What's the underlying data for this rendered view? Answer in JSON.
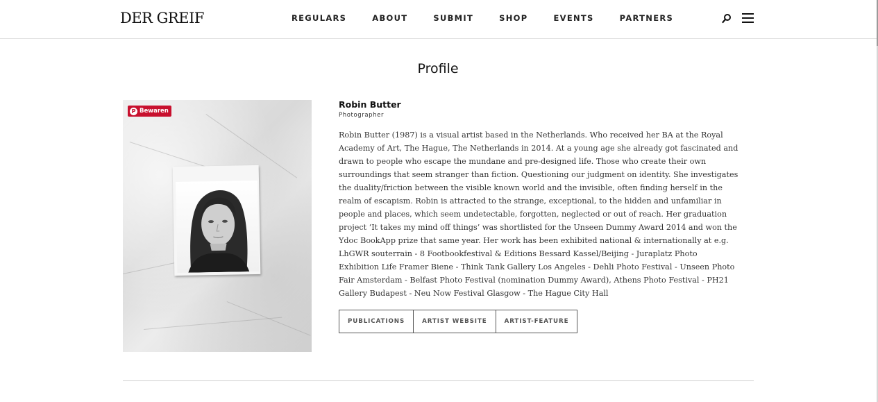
{
  "header": {
    "logo": "DER GREIF",
    "nav": [
      "REGULARS",
      "ABOUT",
      "SUBMIT",
      "SHOP",
      "EVENTS",
      "PARTNERS"
    ],
    "icons": [
      "search-icon",
      "hamburger-menu-icon"
    ]
  },
  "page": {
    "title": "Profile"
  },
  "profile": {
    "pin_button_label": "Bewaren",
    "name": "Robin Butter",
    "role": "Photographer",
    "bio_lines": [
      "Robin Butter (1987) is a visual artist based in the Netherlands. Who received her BA at the Royal",
      "Academy of Art, The Hague, The Netherlands in 2014. At a young age she already got fascinated and",
      "drawn to people who escape the mundane and pre-designed life.  Those who create their own",
      "surroundings that seem stranger than fiction.  Questioning our judgment on identity. She investigates",
      "the duality/friction between the visible known world and the invisible, often finding herself in the",
      "realm of escapism.  Robin is attracted to the strange, exceptional, to the hidden and unfamiliar in",
      "people and places, which seem undetectable, forgotten, neglected or out of reach. Her graduation",
      "project ‘It takes my mind off things’ was shortlisted for the Unseen Dummy Award 2014 and won the",
      "Ydoc BookApp prize that same year. Her work has been exhibited national & internationally at e.g.",
      "LhGWR souterrain - 8 Footbookfestival & Editions Bessard Kassel/Beijing - Juraplatz Photo",
      "Exhibition Life Framer Biene - Think Tank Gallery Los Angeles - Dehli Photo Festival - Unseen Photo",
      "Fair Amsterdam - Belfast Photo Festival (nomination Dummy Award), Athens Photo Festival - PH21",
      "Gallery Budapest - Neu Now Festival Glasgow - The Hague City Hall"
    ],
    "buttons": [
      "PUBLICATIONS",
      "ARTIST WEBSITE",
      "ARTIST-FEATURE"
    ]
  },
  "colors": {
    "pin_red": "#c8102e",
    "text": "#111111",
    "border": "#555555"
  }
}
